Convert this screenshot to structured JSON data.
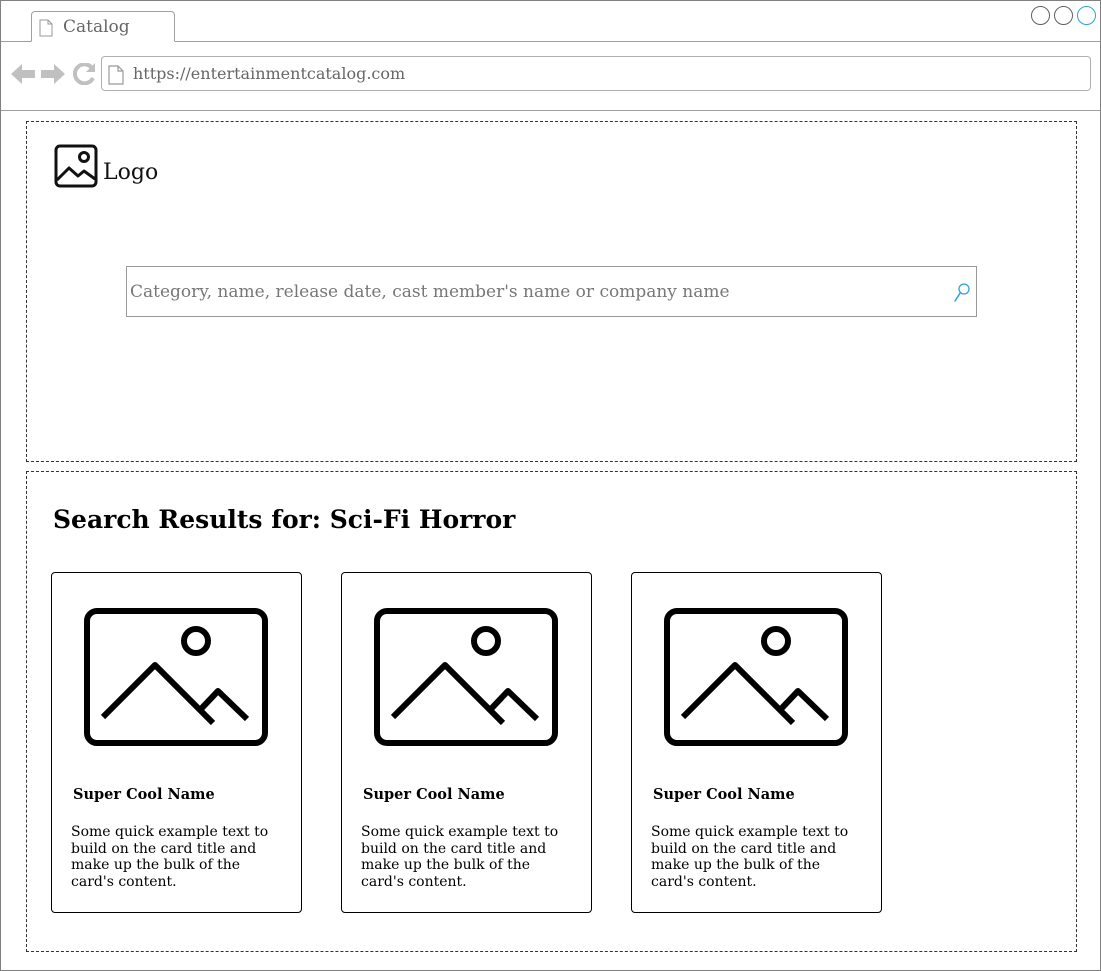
{
  "browser": {
    "tab_title": "Catalog",
    "url": "https://entertainmentcatalog.com"
  },
  "header": {
    "logo_label": "Logo",
    "search": {
      "placeholder": "Category, name, release date, cast member's name or company name",
      "value": ""
    }
  },
  "results": {
    "title": "Search Results for: Sci-Fi Horror",
    "cards": [
      {
        "title": "Super Cool Name",
        "text": "Some quick example text to build on the card title and make up the bulk of the card's content."
      },
      {
        "title": "Super Cool Name",
        "text": "Some quick example text to build on the card title and make up the bulk of the card's content."
      },
      {
        "title": "Super Cool Name",
        "text": "Some quick example text to build on the card title and make up the bulk of the card's content."
      }
    ]
  },
  "icons": {
    "tab": "page-icon",
    "url": "page-icon",
    "logo": "image-icon",
    "search": "search-icon",
    "card_image": "image-placeholder-icon"
  },
  "colors": {
    "accent": "#2aa3d8",
    "nav_icons": "#c0c0c0",
    "border": "#333333"
  }
}
